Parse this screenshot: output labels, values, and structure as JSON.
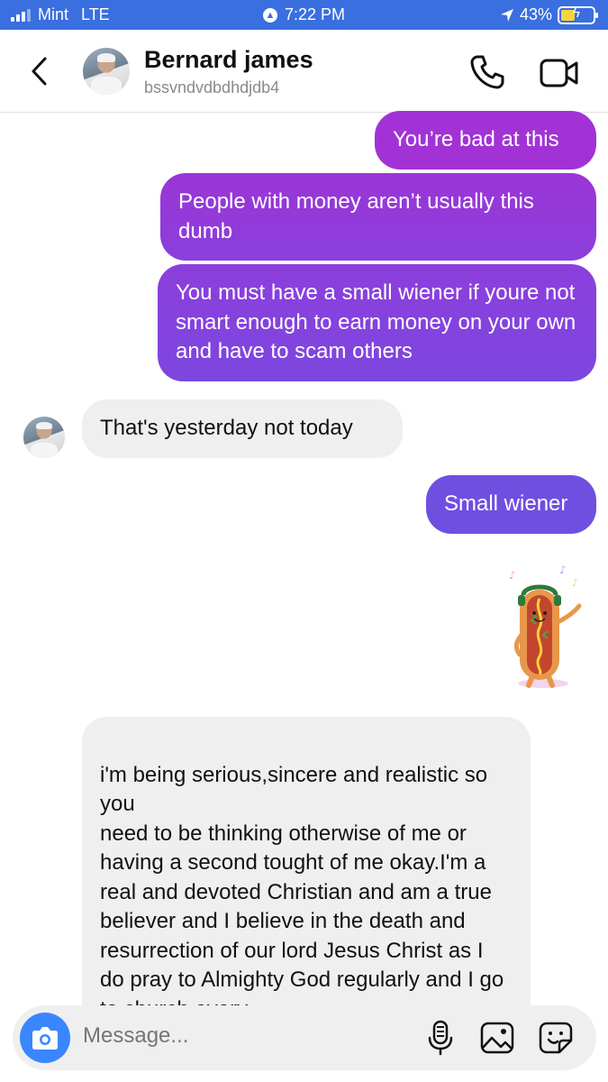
{
  "status_bar": {
    "carrier": "Mint",
    "network": "LTE",
    "time": "7:22 PM",
    "battery": "43%",
    "battery_level": 0.43,
    "colors": {
      "background": "#3a6fe0",
      "battery_fill": "#f5d43c"
    }
  },
  "header": {
    "back_icon": "chevron-left-icon",
    "name": "Bernard james",
    "username": "bssvndvdbdhdjdb4",
    "call_icon": "phone-icon",
    "video_icon": "video-camera-icon"
  },
  "messages": [
    {
      "direction": "outgoing",
      "text": "You’re bad at this"
    },
    {
      "direction": "outgoing",
      "text": "People with money aren’t usually this dumb"
    },
    {
      "direction": "outgoing",
      "text": "You must have a small wiener if youre not smart enough to earn money on your own and have to scam others"
    },
    {
      "direction": "incoming",
      "text": "That's yesterday not today"
    },
    {
      "direction": "outgoing",
      "text": "Small wiener"
    },
    {
      "direction": "outgoing",
      "type": "sticker",
      "sticker": "dancing-hotdog-sticker"
    },
    {
      "direction": "incoming",
      "text": "i'm being serious,sincere and realistic so you\n need to be thinking otherwise of me or having a second tought of me okay.I'm a real and devoted Christian and am a true believer and I believe in the death and resurrection of our lord Jesus Christ as I do pray to Almighty God regularly and I go to church every"
    }
  ],
  "composer": {
    "placeholder": "Message...",
    "camera_icon": "camera-icon",
    "mic_icon": "microphone-icon",
    "gallery_icon": "image-icon",
    "sticker_icon": "sticker-icon"
  },
  "colors": {
    "outgoing_top": "#a232d6",
    "outgoing_bottom": "#6f4fe0",
    "incoming": "#efefef",
    "camera": "#3a86ff"
  }
}
